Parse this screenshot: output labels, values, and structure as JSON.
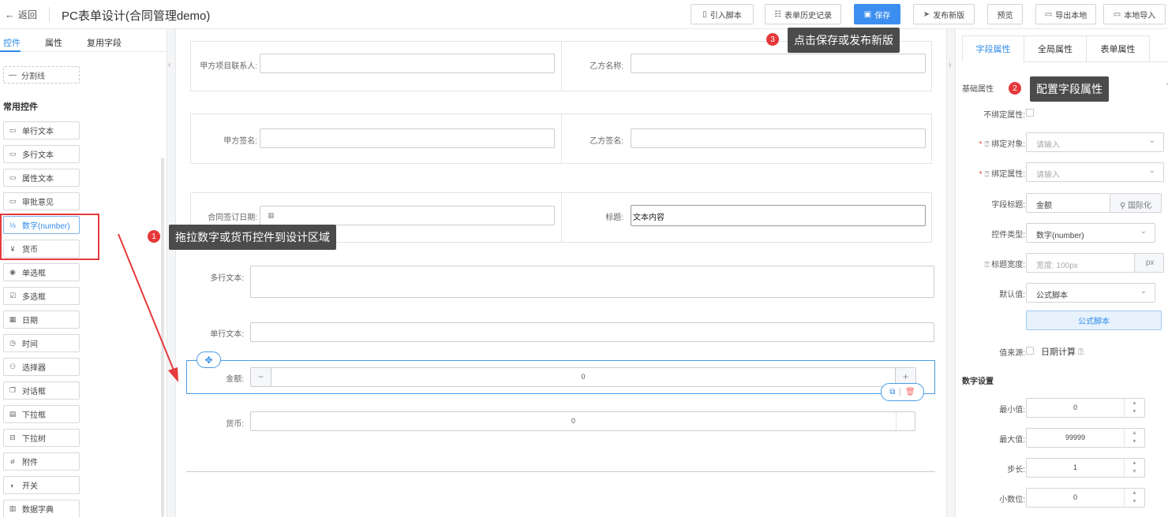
{
  "header": {
    "back_label": "返回",
    "title": "PC表单设计(合同管理demo)",
    "buttons": {
      "import_script": "引入脚本",
      "history": "表单历史记录",
      "save": "保存",
      "publish": "发布新版",
      "preview": "预览",
      "export": "导出本地",
      "import_local": "本地导入"
    }
  },
  "left_panel": {
    "tabs": [
      "控件",
      "属性",
      "复用字段"
    ],
    "divider_label": "分割线",
    "section_title": "常用控件",
    "controls": [
      {
        "label": "单行文本",
        "icon": "textbox-icon"
      },
      {
        "label": "多行文本",
        "icon": "textarea-icon"
      },
      {
        "label": "属性文本",
        "icon": "property-text-icon"
      },
      {
        "label": "审批意见",
        "icon": "approval-icon"
      },
      {
        "label": "数字(number)",
        "icon": "number-icon"
      },
      {
        "label": "货币",
        "icon": "currency-icon"
      },
      {
        "label": "单选框",
        "icon": "radio-icon"
      },
      {
        "label": "多选框",
        "icon": "checkbox-icon"
      },
      {
        "label": "日期",
        "icon": "calendar-icon"
      },
      {
        "label": "时间",
        "icon": "clock-icon"
      },
      {
        "label": "选择器",
        "icon": "user-picker-icon"
      },
      {
        "label": "对话框",
        "icon": "dialog-icon"
      },
      {
        "label": "下拉框",
        "icon": "dropdown-icon"
      },
      {
        "label": "下拉树",
        "icon": "tree-icon"
      },
      {
        "label": "附件",
        "icon": "paperclip-icon"
      },
      {
        "label": "开关",
        "icon": "toggle-icon"
      },
      {
        "label": "数据字典",
        "icon": "book-icon"
      }
    ]
  },
  "canvas": {
    "rows": [
      {
        "left_label": "甲方项目联系人:",
        "right_label": "乙方名称:"
      },
      {
        "left_label": "甲方签名:",
        "right_label": "乙方签名:"
      },
      {
        "left_label": "合同签订日期:",
        "right_label": "标题:",
        "right_value": "文本内容"
      }
    ],
    "multiline_label": "多行文本:",
    "singleline_label": "单行文本:",
    "amount_label": "金额:",
    "amount_value": "0",
    "currency_label": "货币:",
    "currency_value": "0"
  },
  "right_panel": {
    "tabs": [
      "字段属性",
      "全局属性",
      "表单属性"
    ],
    "basic_title": "基础属性",
    "fields": {
      "unbind_label": "不绑定属性:",
      "bind_object_label": "绑定对象:",
      "bind_object_placeholder": "请输入",
      "bind_attr_label": "绑定属性:",
      "bind_attr_placeholder": "请输入",
      "field_title_label": "字段标题:",
      "field_title_value": "金额",
      "i18n_label": "国际化",
      "control_type_label": "控件类型:",
      "control_type_value": "数字(number)",
      "title_width_label": "标题宽度:",
      "title_width_placeholder": "宽度: 100px",
      "title_width_unit": "px",
      "default_label": "默认值:",
      "default_value": "公式脚本",
      "formula_button": "公式脚本",
      "source_label": "值来源:",
      "date_calc_label": "日期计算"
    },
    "number_settings": {
      "title": "数字设置",
      "min_label": "最小值:",
      "min_value": "0",
      "max_label": "最大值:",
      "max_value": "99999",
      "step_label": "步长:",
      "step_value": "1",
      "decimal_label": "小数位:",
      "decimal_value": "0"
    }
  },
  "callouts": [
    {
      "num": "1",
      "text": "拖拉数字或货币控件到设计区域"
    },
    {
      "num": "2",
      "text": "配置字段属性"
    },
    {
      "num": "3",
      "text": "点击保存或发布新版"
    }
  ],
  "colors": {
    "accent": "#2f8bea",
    "primary_button": "#3c8ff0",
    "annotation_red": "#e5393b"
  }
}
